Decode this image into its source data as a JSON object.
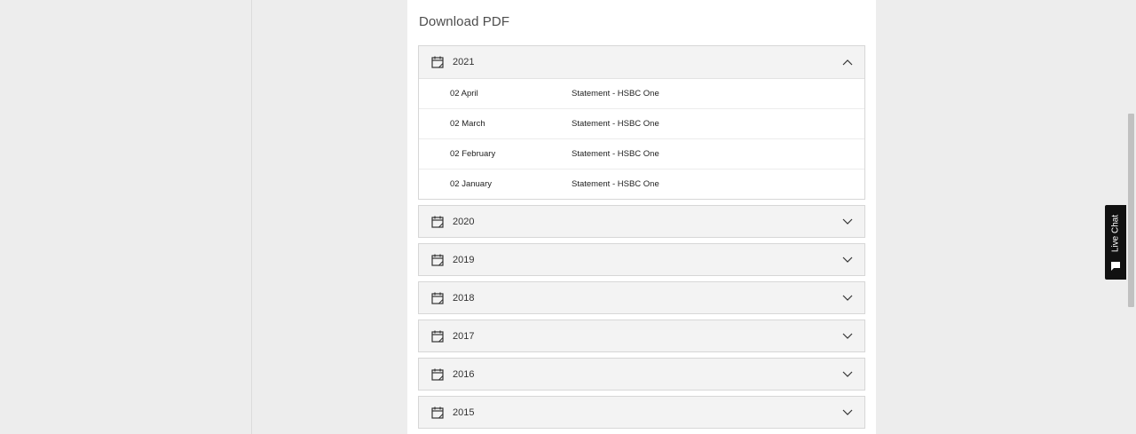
{
  "page": {
    "title": "Download PDF"
  },
  "sections": [
    {
      "year": "2021",
      "expanded": true,
      "statements": [
        {
          "date": "02 April",
          "name": "Statement - HSBC One"
        },
        {
          "date": "02 March",
          "name": "Statement - HSBC One"
        },
        {
          "date": "02 February",
          "name": "Statement - HSBC One"
        },
        {
          "date": "02 January",
          "name": "Statement - HSBC One"
        }
      ]
    },
    {
      "year": "2020",
      "expanded": false
    },
    {
      "year": "2019",
      "expanded": false
    },
    {
      "year": "2018",
      "expanded": false
    },
    {
      "year": "2017",
      "expanded": false
    },
    {
      "year": "2016",
      "expanded": false
    },
    {
      "year": "2015",
      "expanded": false
    }
  ],
  "live_chat": {
    "label": "Live Chat",
    "icon": "chat-bubble-icon"
  },
  "icons": {
    "section": "calendar-icon",
    "expanded": "chevron-up-icon",
    "collapsed": "chevron-down-icon"
  },
  "colors": {
    "background": "#ededed",
    "panel": "#ffffff",
    "header": "#f3f3f3",
    "chat": "#111111"
  }
}
